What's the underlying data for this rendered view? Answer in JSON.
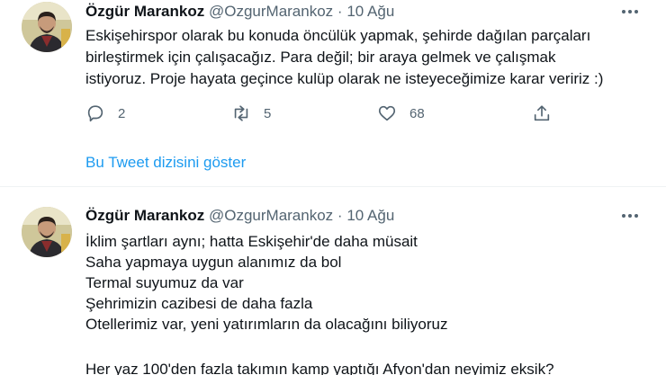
{
  "tweet1": {
    "name": "Özgür Marankoz",
    "handle": "@OzgurMarankoz",
    "separator": "·",
    "date": "10 Ağu",
    "lines": [
      "Eskişehirspor olarak bu konuda öncülük yapmak, şehirde dağılan parçaları",
      "birleştirmek için çalışacağız. Para değil; bir araya gelmek ve çalışmak",
      "istiyoruz. Proje hayata geçince kulüp olarak ne isteyeceğimize karar veririz :)"
    ],
    "actions": {
      "reply_count": "2",
      "retweet_count": "5",
      "like_count": "68"
    }
  },
  "show_thread": "Bu Tweet dizisini göster",
  "tweet2": {
    "name": "Özgür Marankoz",
    "handle": "@OzgurMarankoz",
    "separator": "·",
    "date": "10 Ağu",
    "lines": [
      "İklim şartları aynı; hatta Eskişehir'de daha müsait",
      "Saha yapmaya uygun alanımız da bol",
      "Termal suyumuz da var",
      "Şehrimizin cazibesi de daha fazla",
      "Otellerimiz var, yeni yatırımların da olacağını biliyoruz",
      "Her yaz 100'den fazla takımın kamp yaptığı Afyon'dan neyimiz eksik?"
    ]
  },
  "colors": {
    "text": "#0f1419",
    "secondary": "#536471",
    "link": "#1d9bf0"
  },
  "icons": [
    "reply-icon",
    "retweet-icon",
    "like-icon",
    "share-icon",
    "more-icon"
  ]
}
